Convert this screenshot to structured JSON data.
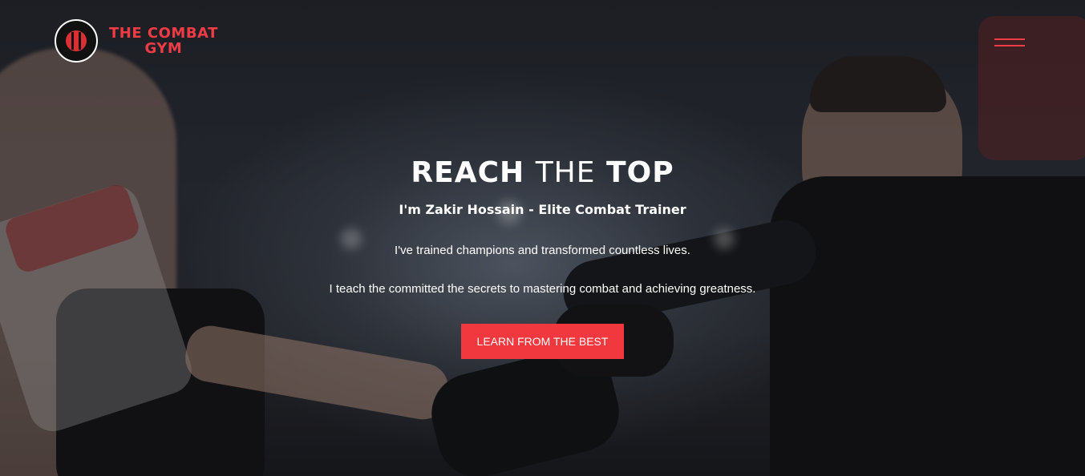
{
  "header": {
    "brand_line1": "THE COMBAT",
    "brand_line2": "GYM",
    "menu_icon": "hamburger-menu-icon"
  },
  "hero": {
    "headline_word1": "REACH",
    "headline_word2": "THE",
    "headline_word3": "TOP",
    "subtitle": "I'm Zakir Hossain - Elite Combat Trainer",
    "paragraph1": "I've trained champions and transformed countless lives.",
    "paragraph2": "I teach the committed the secrets to mastering combat and achieving greatness.",
    "cta_label": "LEARN FROM THE BEST"
  },
  "colors": {
    "accent": "#ef3c44",
    "button": "#f2383f",
    "text": "#ffffff"
  }
}
